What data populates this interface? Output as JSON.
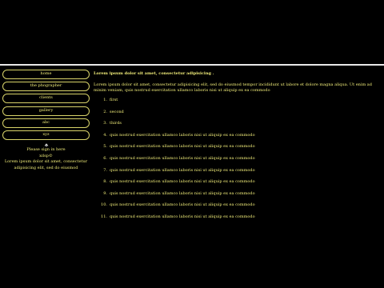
{
  "nav": {
    "items": [
      "home",
      "the phographer",
      "clients",
      "gallery",
      "abc",
      "xyz"
    ]
  },
  "sidebar": {
    "signin_text": "Please sign in here",
    "brand": "xdsp©",
    "blurb": "Lorem ipsum dolor sit amet, consectetur adipisicing elit, sed do eiusmod"
  },
  "main": {
    "heading": "Lorem ipsum dolor sit amet, consectetur adipisicing .",
    "paragraph": "Lorem ipsum dolor sit amet, consectetur adipisicing elit, sed do eiusmod tempor incididunt ut labore et dolore magna aliqua. Ut enim ad minim veniam, quis nostrud exercitation ullamco laboris nisi ut aliquip ex ea commodo",
    "list": [
      {
        "num": "1.",
        "text": "first"
      },
      {
        "num": "2.",
        "text": "second"
      },
      {
        "num": "3.",
        "text": "thirds"
      },
      {
        "num": "4.",
        "text": "quis nostrud exercitation ullamco laboris nisi ut aliquip ex ea commodo"
      },
      {
        "num": "5.",
        "text": "quis nostrud exercitation ullamco laboris nisi ut aliquip ex ea commodo"
      },
      {
        "num": "6.",
        "text": "quis nostrud exercitation ullamco laboris nisi ut aliquip ex ea commodo"
      },
      {
        "num": "7.",
        "text": "quis nostrud exercitation ullamco laboris nisi ut aliquip ex ea commodo"
      },
      {
        "num": "8.",
        "text": "quis nostrud exercitation ullamco laboris nisi ut aliquip ex ea commodo"
      },
      {
        "num": "9.",
        "text": "quis nostrud exercitation ullamco laboris nisi ut aliquip ex ea commodo"
      },
      {
        "num": "10.",
        "text": "quis nostrud exercitation ullamco laboris nisi ut aliquip ex ea commodo"
      },
      {
        "num": "11.",
        "text": "quis nostrud exercitation ullamco laboris nisi ut aliquip ex ea commodo"
      }
    ]
  },
  "colors": {
    "background": "#000000",
    "text": "#f2ee7a",
    "border": "#d9d46a",
    "divider": "#e8e8e8"
  }
}
